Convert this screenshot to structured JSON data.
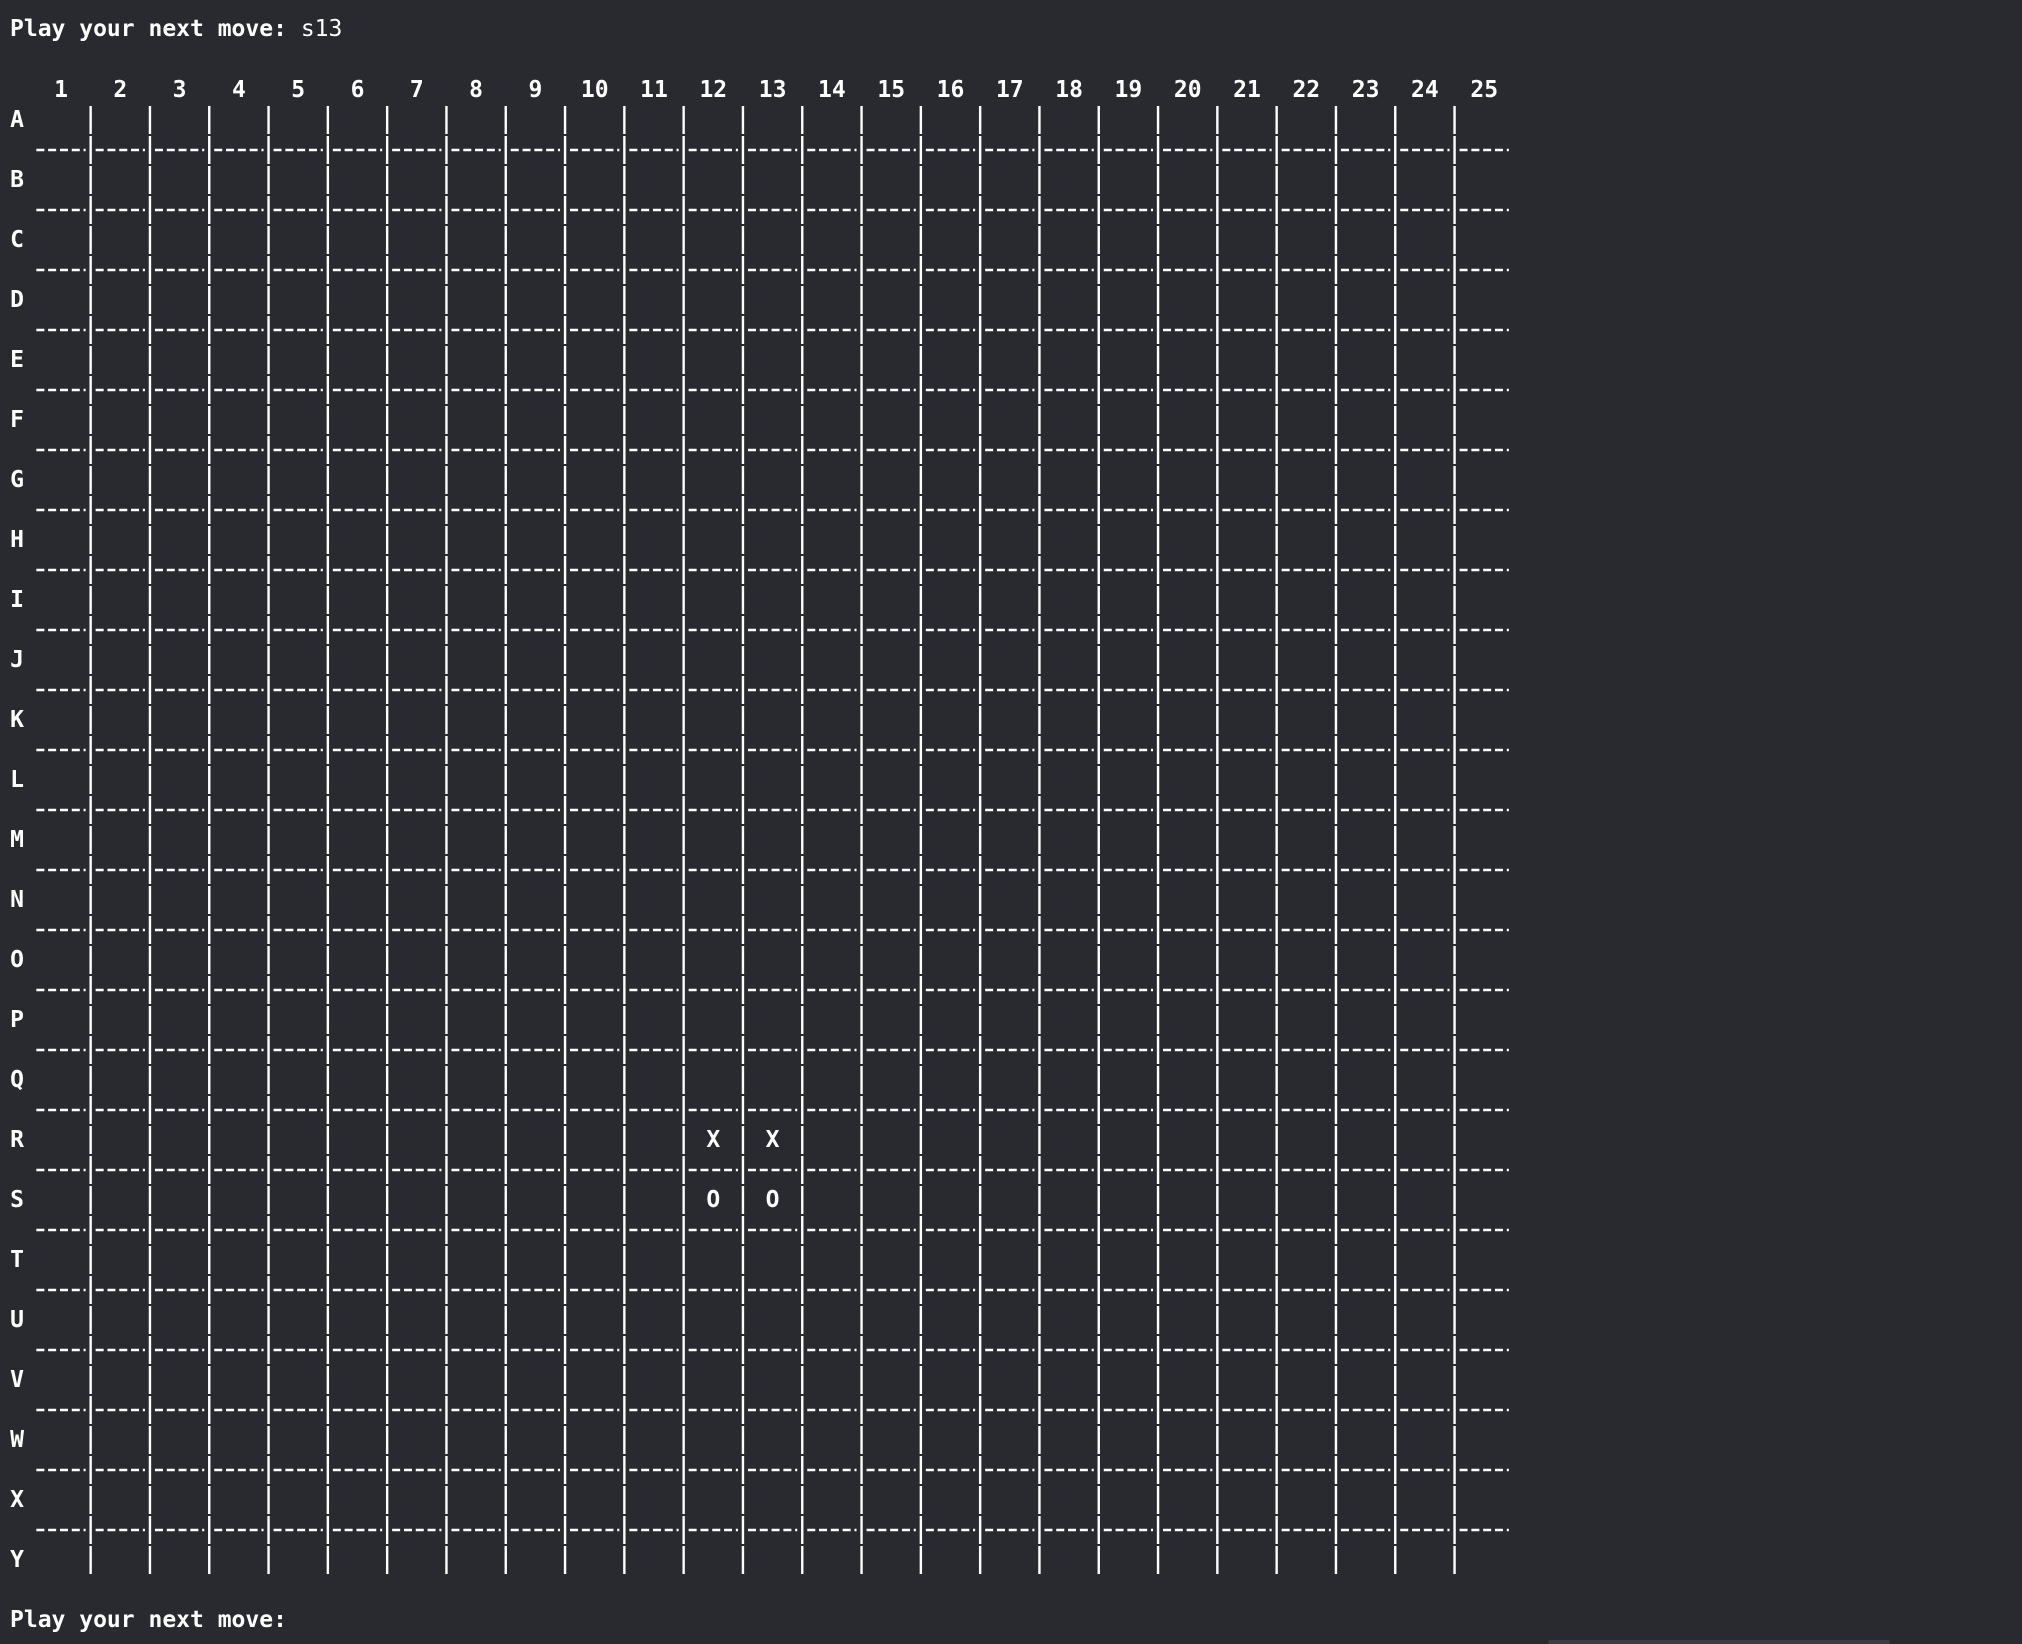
{
  "terminal": {
    "previous_prompt_label": "Play your next move:",
    "previous_input": "s13",
    "current_prompt_label": "Play your next move:",
    "current_input": ""
  },
  "board": {
    "columns": [
      "1",
      "2",
      "3",
      "4",
      "5",
      "6",
      "7",
      "8",
      "9",
      "10",
      "11",
      "12",
      "13",
      "14",
      "15",
      "16",
      "17",
      "18",
      "19",
      "20",
      "21",
      "22",
      "23",
      "24",
      "25"
    ],
    "rows": [
      "A",
      "B",
      "C",
      "D",
      "E",
      "F",
      "G",
      "H",
      "I",
      "J",
      "K",
      "L",
      "M",
      "N",
      "O",
      "P",
      "Q",
      "R",
      "S",
      "T",
      "U",
      "V",
      "W",
      "X",
      "Y"
    ],
    "cell_separator": "|",
    "row_separator": "---",
    "pieces": [
      {
        "row": "R",
        "col": "12",
        "mark": "X"
      },
      {
        "row": "R",
        "col": "13",
        "mark": "X"
      },
      {
        "row": "S",
        "col": "12",
        "mark": "O"
      },
      {
        "row": "S",
        "col": "13",
        "mark": "O"
      }
    ]
  }
}
